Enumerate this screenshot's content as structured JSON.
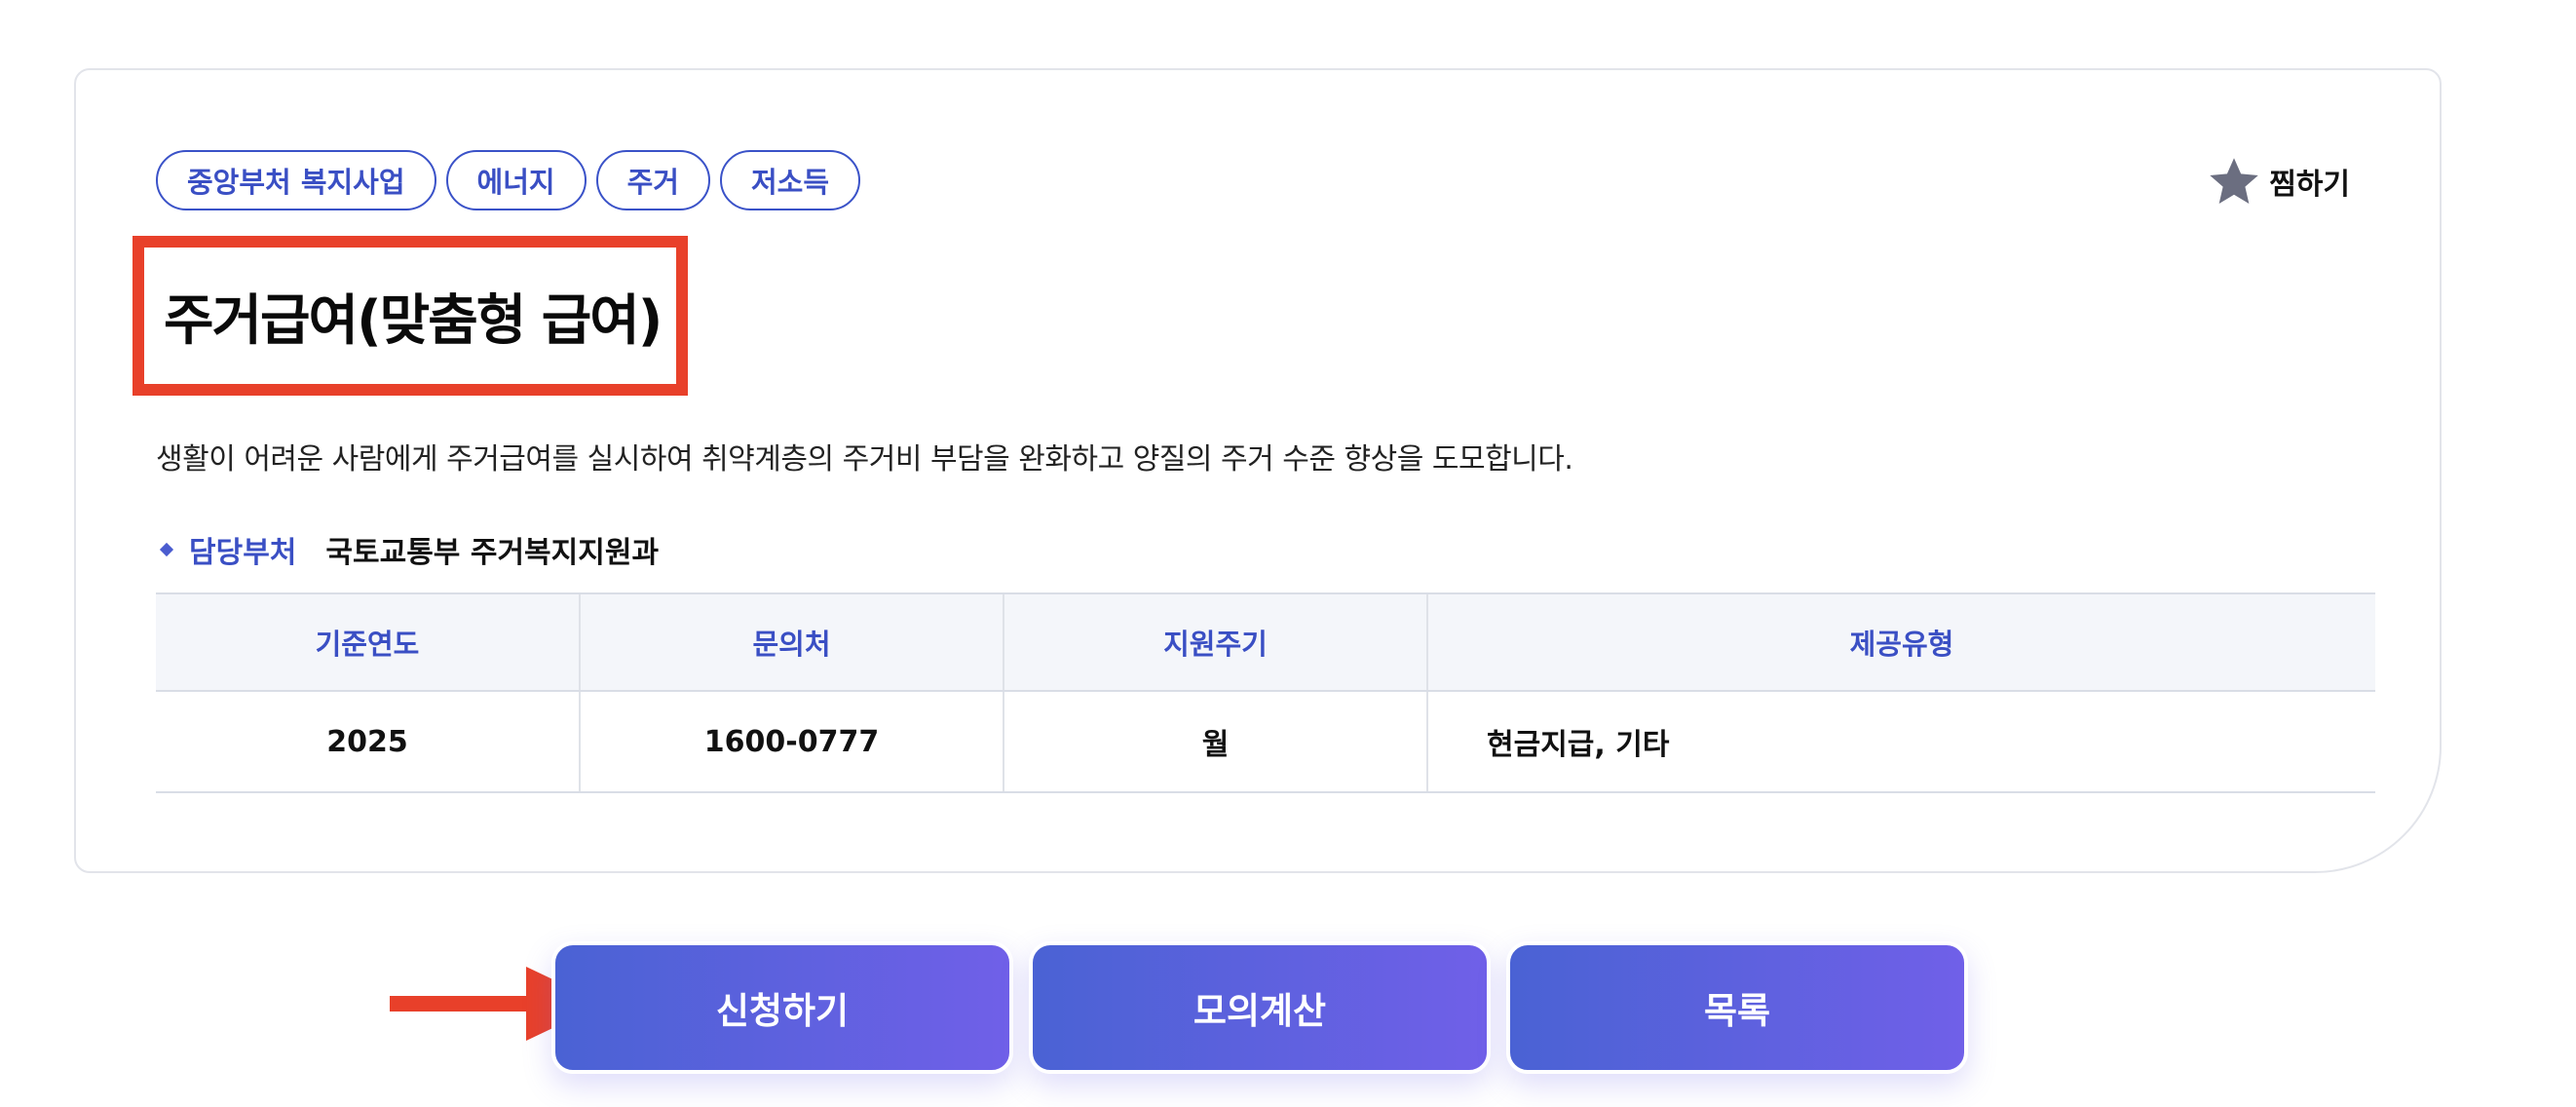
{
  "tags": [
    "중앙부처 복지사업",
    "에너지",
    "주거",
    "저소득"
  ],
  "bookmark": {
    "label": "찜하기",
    "icon": "star-icon",
    "icon_color": "#6b6e80"
  },
  "title": "주거급여(맞춤형 급여)",
  "description": "생활이 어려운 사람에게 주거급여를 실시하여 취약계층의 주거비 부담을 완화하고 양질의 주거 수준 향상을 도모합니다.",
  "department": {
    "label": "담당부처",
    "value": "국토교통부 주거복지지원과"
  },
  "info_table": {
    "headers": [
      "기준연도",
      "문의처",
      "지원주기",
      "제공유형"
    ],
    "values": [
      "2025",
      "1600-0777",
      "월",
      "현금지급, 기타"
    ]
  },
  "actions": {
    "apply": "신청하기",
    "simulate": "모의계산",
    "list": "목록"
  },
  "colors": {
    "accent": "#3a4fc4",
    "highlight": "#e8402a",
    "button_gradient_start": "#4a62d4",
    "button_gradient_end": "#7060e8"
  }
}
